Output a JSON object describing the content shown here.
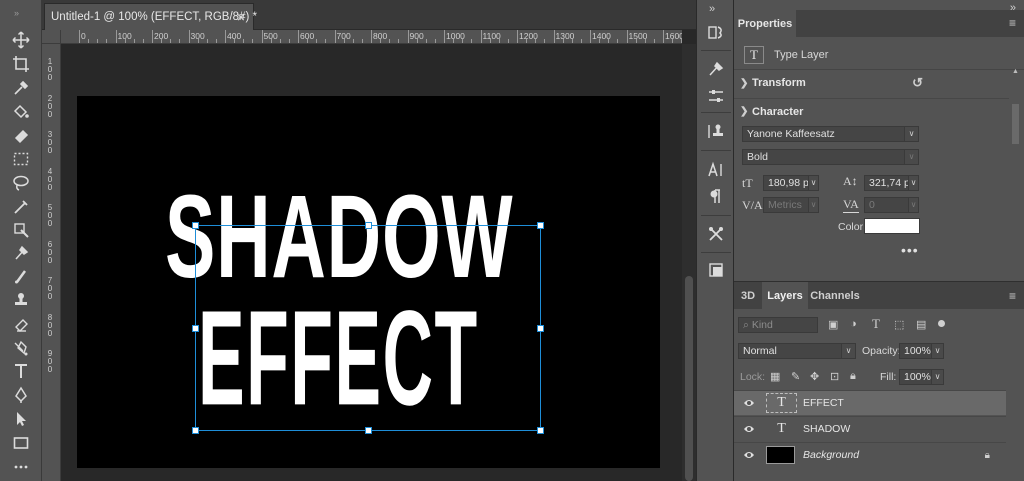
{
  "document": {
    "tab_title": "Untitled-1 @ 100% (EFFECT, RGB/8#) *",
    "close_glyph": "×"
  },
  "rulers": {
    "horizontal": [
      "0",
      "100",
      "200",
      "300",
      "400",
      "500",
      "600",
      "700",
      "800",
      "900",
      "1000",
      "1100",
      "1200",
      "1300",
      "1400",
      "1500",
      "1600"
    ],
    "vertical": [
      "1",
      "2",
      "3",
      "4",
      "5",
      "6",
      "7",
      "8",
      "9"
    ]
  },
  "canvas": {
    "line1": "SHADOW",
    "line2": "EFFECT",
    "background_color": "#000000",
    "text_color": "#ffffff",
    "selection_color": "#1e8ed8"
  },
  "toolbar": {
    "grip": "»",
    "tools": [
      "move-icon",
      "crop-icon",
      "eyedropper-icon",
      "paint-bucket-icon",
      "eraser-icon",
      "marquee-icon",
      "lasso-icon",
      "pen-icon",
      "quick-select-icon",
      "brush-icon",
      "spot-healing-icon",
      "stamp-icon",
      "history-brush-icon",
      "gradient-icon",
      "type-icon",
      "pen-path-icon",
      "path-select-icon",
      "rectangle-icon",
      "more-tools-icon"
    ]
  },
  "strip": {
    "collapse": "»",
    "icons": [
      "history-icon",
      "brushes-icon",
      "adjust-icon",
      "clone-source-icon",
      "character-icon",
      "paragraph-icon",
      "tool-presets-icon",
      "layer-comps-icon"
    ]
  },
  "properties": {
    "collapse": "»",
    "tab": "Properties",
    "menu": "≡",
    "layer_type": "Type Layer",
    "type_glyph": "T",
    "transform_label": "Transform",
    "character_label": "Character",
    "font_family": "Yanone Kaffeesatz",
    "font_style": "Bold",
    "font_size": "180,98 p",
    "leading": "321,74 p",
    "kerning": "Metrics",
    "tracking": "0",
    "color_label": "Color",
    "text_color": "#ffffff",
    "more": "•••"
  },
  "layers_panel": {
    "tabs": [
      "3D",
      "Layers",
      "Channels"
    ],
    "active_tab": "Layers",
    "menu": "≡",
    "filter_kind": "Kind",
    "blend_mode": "Normal",
    "opacity_label": "Opacity:",
    "opacity": "100%",
    "lock_label": "Lock:",
    "fill_label": "Fill:",
    "fill": "100%",
    "layers": [
      {
        "name": "EFFECT",
        "kind": "text",
        "selected": true
      },
      {
        "name": "SHADOW",
        "kind": "text",
        "selected": false
      },
      {
        "name": "Background",
        "kind": "fill",
        "selected": false,
        "locked": true
      }
    ]
  }
}
